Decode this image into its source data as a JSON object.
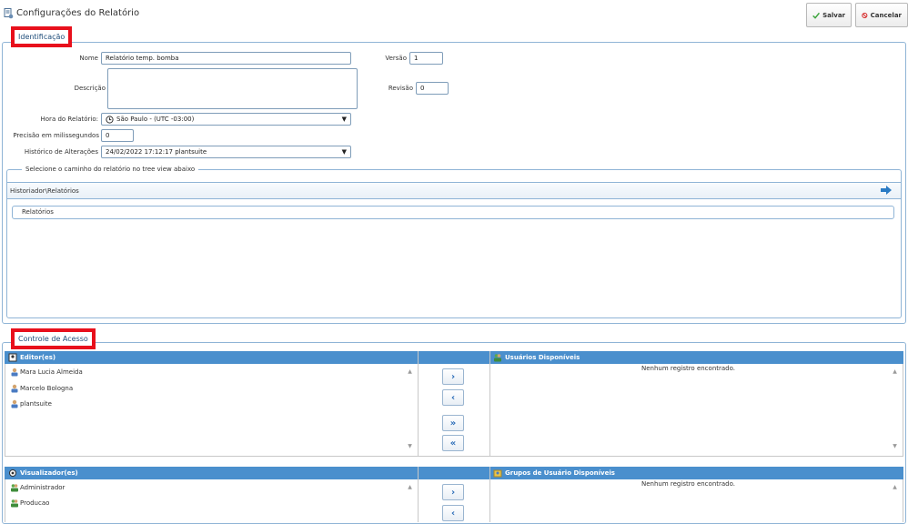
{
  "header": {
    "title": "Configurações do Relatório",
    "save_label": "Salvar",
    "cancel_label": "Cancelar"
  },
  "identification": {
    "legend": "Identificação",
    "name_label": "Nome",
    "name_value": "Relatório temp. bomba",
    "version_label": "Versão",
    "version_value": "1",
    "description_label": "Descrição",
    "description_value": "",
    "revision_label": "Revisão",
    "revision_value": "0",
    "timezone_label": "Hora do Relatório:",
    "timezone_value": "São Paulo - (UTC -03:00)",
    "precision_label": "Precisão em milissegundos",
    "precision_value": "0",
    "history_label": "Histórico de Alterações",
    "history_value": "24/02/2022 17:12:17 plantsuite"
  },
  "tree": {
    "legend": "Selecione o caminho do relatório no tree view abaixo",
    "path": "Historiador\\Relatórios",
    "node": "Relatórios"
  },
  "access": {
    "legend": "Controle de Acesso",
    "editors_title": "Editor(es)",
    "editors": [
      "Mara Lucia Almeida",
      "Marcelo Bologna",
      "plantsuite"
    ],
    "users_title": "Usuários Disponíveis",
    "users_empty": "Nenhum registro encontrado.",
    "viewers_title": "Visualizador(es)",
    "viewers": [
      "Administrador",
      "Producao"
    ],
    "groups_title": "Grupos de Usuário Disponíveis",
    "groups_empty": "Nenhum registro encontrado.",
    "move_right": "›",
    "move_left": "‹",
    "move_all_right": "»",
    "move_all_left": "«"
  },
  "colors": {
    "accent": "#4a8fcd",
    "legend_border": "#e8101c",
    "fieldset_border": "#8fb4d6"
  }
}
